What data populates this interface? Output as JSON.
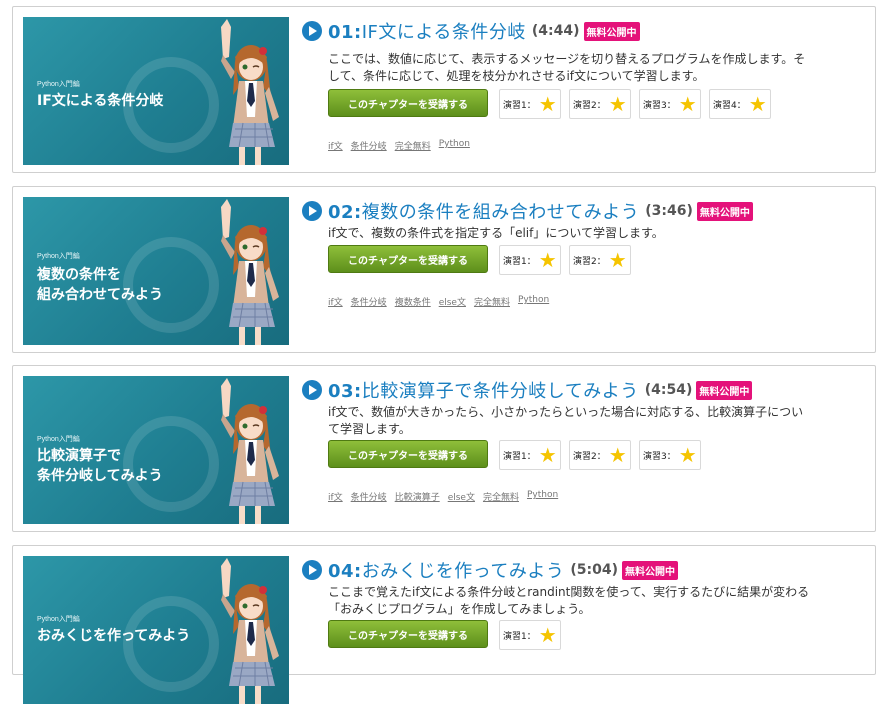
{
  "chapters": [
    {
      "num": "01:",
      "title": "IF文による条件分岐",
      "duration": "(4:44)",
      "badge": "無料公開中",
      "description_lines": [
        "ここでは、数値に応じて、表示するメッセージを切り替えるプログラムを作成します。そ",
        "して、条件に応じて、処理を枝分かれさせるif文について学習します。"
      ],
      "button": "このチャプターを受講する",
      "exercises": [
        "演習1：",
        "演習2：",
        "演習3：",
        "演習4："
      ],
      "tags": [
        "if文",
        "条件分岐",
        "完全無料",
        "Python"
      ],
      "thumb_series": "Python入門編",
      "thumb_title": [
        "IF文による条件分岐"
      ]
    },
    {
      "num": "02:",
      "title": "複数の条件を組み合わせてみよう",
      "duration": "(3:46)",
      "badge": "無料公開中",
      "description_lines": [
        "if文で、複数の条件式を指定する「elif」について学習します。"
      ],
      "button": "このチャプターを受講する",
      "exercises": [
        "演習1：",
        "演習2："
      ],
      "tags": [
        "if文",
        "条件分岐",
        "複数条件",
        "else文",
        "完全無料",
        "Python"
      ],
      "thumb_series": "Python入門編",
      "thumb_title": [
        "複数の条件を",
        "組み合わせてみよう"
      ]
    },
    {
      "num": "03:",
      "title": "比較演算子で条件分岐してみよう",
      "duration": "(4:54)",
      "badge": "無料公開中",
      "description_lines": [
        "if文で、数値が大きかったら、小さかったらといった場合に対応する、比較演算子につい",
        "て学習します。"
      ],
      "button": "このチャプターを受講する",
      "exercises": [
        "演習1：",
        "演習2：",
        "演習3："
      ],
      "tags": [
        "if文",
        "条件分岐",
        "比較演算子",
        "else文",
        "完全無料",
        "Python"
      ],
      "thumb_series": "Python入門編",
      "thumb_title": [
        "比較演算子で",
        "条件分岐してみよう"
      ]
    },
    {
      "num": "04:",
      "title": "おみくじを作ってみよう",
      "duration": "(5:04)",
      "badge": "無料公開中",
      "description_lines": [
        "ここまで覚えたif文による条件分岐とrandint関数を使って、実行するたびに結果が変わる",
        "「おみくじプログラム」を作成してみましょう。"
      ],
      "button": "このチャプターを受講する",
      "exercises": [
        "演習1："
      ],
      "tags": [],
      "thumb_series": "Python入門編",
      "thumb_title": [
        "おみくじを作ってみよう"
      ]
    }
  ],
  "colors": {
    "title": "#1b7fc0",
    "badge": "#e4127a",
    "button": "#6c9e22",
    "thumb_bg": "#2389a0",
    "star": "#f5c400"
  },
  "icons": {
    "play": "play-circle-icon",
    "star": "star-icon"
  }
}
